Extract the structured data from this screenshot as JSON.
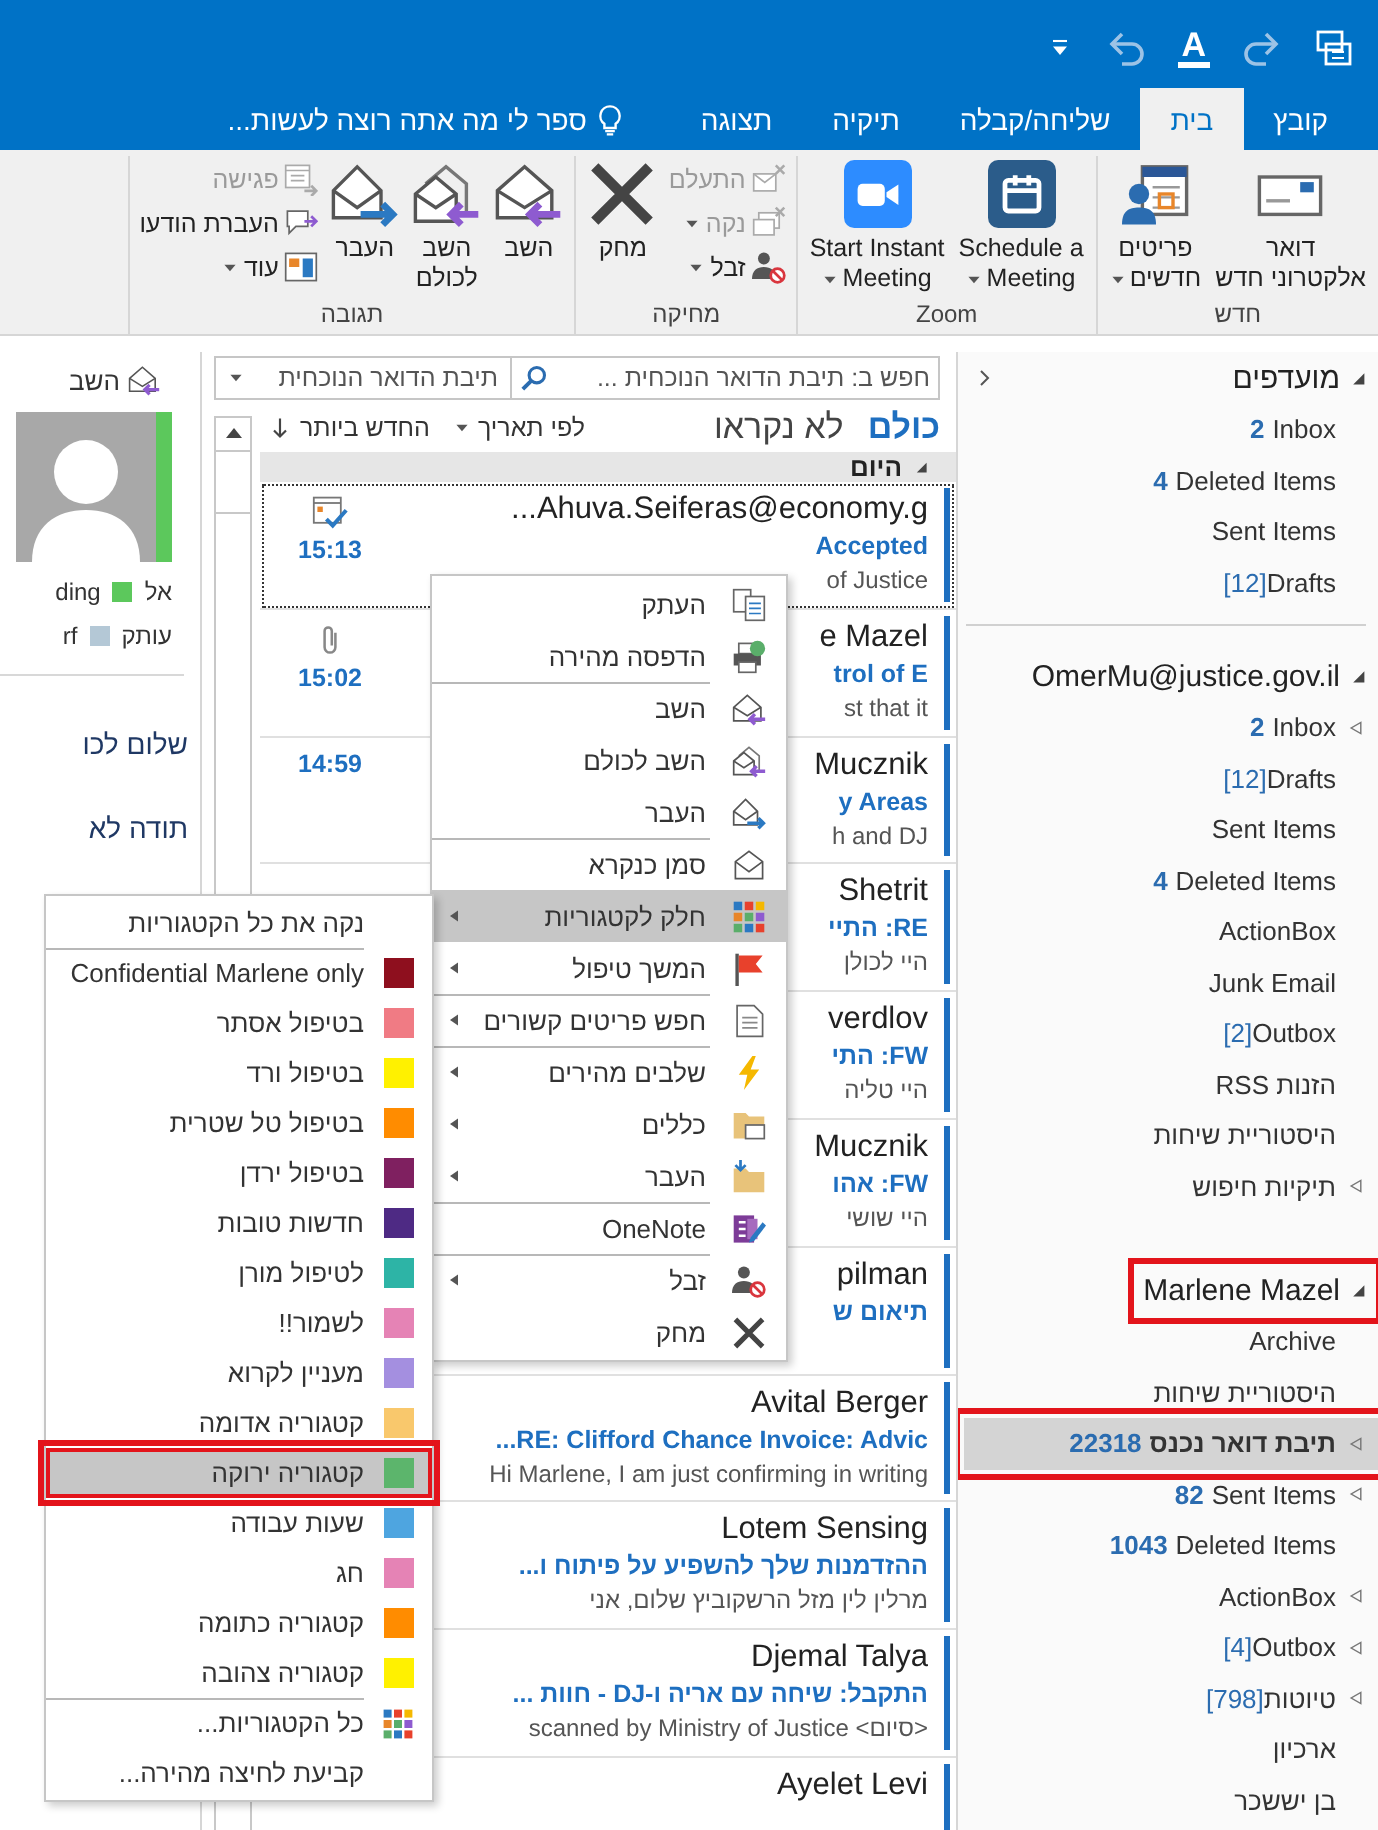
{
  "quick_access": [
    {
      "kind": "send-receive"
    },
    {
      "kind": "redo"
    },
    {
      "kind": "font",
      "label": "A"
    },
    {
      "kind": "undo"
    },
    {
      "kind": "customize"
    }
  ],
  "tabs": [
    {
      "label": "קובץ",
      "selected": false
    },
    {
      "label": "בית",
      "selected": true
    },
    {
      "label": "שליחה/קבלה",
      "selected": false
    },
    {
      "label": "תיקיה",
      "selected": false
    },
    {
      "label": "תצוגה",
      "selected": false
    }
  ],
  "tell_me": "ספר לי מה אתה רוצה לעשות...",
  "ribbon": [
    {
      "label": "חדש",
      "items": [
        {
          "kind": "new-mail",
          "label": "דואר\nאלקטרוני חדש",
          "dropdown": false,
          "disabled": false
        },
        {
          "kind": "new-items",
          "label": "פריטים\nחדשים",
          "dropdown": true,
          "disabled": false
        }
      ]
    },
    {
      "label": "Zoom",
      "items": [
        {
          "kind": "zoom-schedule",
          "label": "Schedule a\nMeeting",
          "dropdown": true,
          "disabled": false
        },
        {
          "kind": "zoom-video",
          "label": "Start Instant\nMeeting",
          "dropdown": true,
          "disabled": false
        }
      ]
    },
    {
      "label": "מחיקה",
      "items": [
        {
          "kind": "stack",
          "items": [
            {
              "kind": "ignore",
              "label": "התעלם",
              "dropdown": false,
              "disabled": true
            },
            {
              "kind": "cleanup",
              "label": "נקה",
              "dropdown": true,
              "disabled": true
            },
            {
              "kind": "junk",
              "label": "זבל",
              "dropdown": true,
              "disabled": false
            }
          ]
        },
        {
          "kind": "delete",
          "label": "מחק",
          "dropdown": false,
          "disabled": false
        }
      ]
    },
    {
      "label": "תגובה",
      "items": [
        {
          "kind": "reply",
          "label": "השב",
          "dropdown": false,
          "disabled": false
        },
        {
          "kind": "reply-all",
          "label": "השב\nלכולם",
          "dropdown": false,
          "disabled": false
        },
        {
          "kind": "forward",
          "label": "העבר",
          "dropdown": false,
          "disabled": false
        },
        {
          "kind": "stack",
          "items": [
            {
              "kind": "meeting",
              "label": "פגישה",
              "dropdown": false,
              "disabled": true
            },
            {
              "kind": "im",
              "label": "העברת הודעו",
              "dropdown": false,
              "disabled": false
            },
            {
              "kind": "more",
              "label": "עוד",
              "dropdown": true,
              "disabled": false
            }
          ]
        }
      ]
    }
  ],
  "folders": [
    {
      "title": "מועדפים",
      "expanded": true,
      "highlighted": false,
      "items": [
        {
          "name": "Inbox",
          "unread": "2",
          "collapsed": false,
          "selected": false,
          "highlighted": false
        },
        {
          "name": "Deleted Items",
          "unread": "4",
          "collapsed": false,
          "selected": false,
          "highlighted": false
        },
        {
          "name": "Sent Items",
          "collapsed": false,
          "selected": false,
          "highlighted": false
        },
        {
          "name": "Drafts",
          "total": "[12]",
          "collapsed": false,
          "selected": false,
          "highlighted": false
        }
      ]
    },
    {
      "title": "OmerMu@justice.gov.il",
      "expanded": true,
      "highlighted": false,
      "items": [
        {
          "name": "Inbox",
          "unread": "2",
          "collapsed": true,
          "selected": false,
          "highlighted": false
        },
        {
          "name": "Drafts",
          "total": "[12]",
          "collapsed": false,
          "selected": false,
          "highlighted": false
        },
        {
          "name": "Sent Items",
          "collapsed": false,
          "selected": false,
          "highlighted": false
        },
        {
          "name": "Deleted Items",
          "unread": "4",
          "collapsed": false,
          "selected": false,
          "highlighted": false
        },
        {
          "name": "ActionBox",
          "collapsed": false,
          "selected": false,
          "highlighted": false
        },
        {
          "name": "Junk Email",
          "collapsed": false,
          "selected": false,
          "highlighted": false
        },
        {
          "name": "Outbox",
          "total": "[2]",
          "collapsed": false,
          "selected": false,
          "highlighted": false
        },
        {
          "name": "הזנות RSS",
          "collapsed": false,
          "selected": false,
          "highlighted": false
        },
        {
          "name": "היסטוריית שיחות",
          "collapsed": false,
          "selected": false,
          "highlighted": false
        },
        {
          "name": "תיקיות חיפוש",
          "collapsed": true,
          "selected": false,
          "highlighted": false
        }
      ]
    },
    {
      "title": "Marlene Mazel",
      "expanded": true,
      "highlighted": true,
      "items": [
        {
          "name": "Archive",
          "collapsed": false,
          "selected": false,
          "highlighted": false
        },
        {
          "name": "היסטוריית שיחות",
          "collapsed": false,
          "selected": false,
          "highlighted": false
        },
        {
          "name": "תיבת דואר נכנס",
          "unread": "22318",
          "collapsed": true,
          "selected": true,
          "highlighted": true
        },
        {
          "name": "Sent Items",
          "unread": "82",
          "collapsed": true,
          "selected": false,
          "highlighted": false
        },
        {
          "name": "Deleted Items",
          "unread": "1043",
          "collapsed": false,
          "selected": false,
          "highlighted": false
        },
        {
          "name": "ActionBox",
          "collapsed": true,
          "selected": false,
          "highlighted": false
        },
        {
          "name": "Outbox",
          "total": "[4]",
          "collapsed": true,
          "selected": false,
          "highlighted": false
        },
        {
          "name": "טיוטות",
          "total": "[798]",
          "collapsed": true,
          "selected": false,
          "highlighted": false
        },
        {
          "name": "ארכיון",
          "collapsed": false,
          "selected": false,
          "highlighted": false
        },
        {
          "name": "בן יששכר",
          "collapsed": false,
          "selected": false,
          "highlighted": false
        }
      ]
    }
  ],
  "search": {
    "placeholder": "חפש ב: תיבת הדואר הנוכחית ...",
    "scope": "תיבת הדואר הנוכחית"
  },
  "view_filters": [
    {
      "label": "כולם",
      "selected": true
    },
    {
      "label": "לא נקראו",
      "selected": false
    }
  ],
  "sort": {
    "by": "לפי תאריך",
    "order": "החדש ביותר"
  },
  "group_header": "היום",
  "messages": [
    {
      "kind": "meeting",
      "sender": "Ahuva.Seiferas@economy.g...",
      "subject": "Accepted",
      "preview": "of Justice",
      "time": "15:13",
      "selected": true,
      "unread": true
    },
    {
      "kind": "attachment",
      "sender": "e Mazel",
      "subject": "trol of E",
      "preview": "st that it",
      "time": "15:02",
      "selected": false,
      "unread": true
    },
    {
      "kind": "mail",
      "sender": "Mucznik",
      "subject": "y Areas",
      "preview": "h and DJ",
      "time": "14:59",
      "selected": false,
      "unread": true
    },
    {
      "kind": "mail",
      "sender": "Shetrit",
      "subject": "RE: התיי",
      "preview": "היי לכולן",
      "selected": false,
      "unread": true
    },
    {
      "kind": "mail",
      "sender": "verdlov",
      "subject": "FW: התי",
      "preview": "היי טליה",
      "selected": false,
      "unread": true
    },
    {
      "kind": "mail",
      "sender": "Mucznik",
      "subject": "FW: אהו",
      "preview": "היי שושי",
      "selected": false,
      "unread": true
    },
    {
      "kind": "mail",
      "sender": "pilman",
      "subject": "תיאום ש",
      "selected": false,
      "unread": true
    },
    {
      "kind": "mail",
      "sender": "Avital Berger",
      "subject": "RE: Clifford Chance Invoice: Advic...",
      "preview": "Hi Marlene,  I am just confirming in writing",
      "selected": false,
      "unread": true
    },
    {
      "kind": "mail",
      "sender": "Lotem Sensing",
      "subject": "ההזדמנות שלך להשפיע על פיתוח ו...",
      "preview": "מרלין לין מזל הרשקוביץ שלום, אני",
      "selected": false,
      "unread": true
    },
    {
      "kind": "mail",
      "sender": "Djemal Talya",
      "subject": "התקבל: שיחה עם אריה ו-DJ - חוות ...",
      "preview": "<סיום> scanned by Ministry of Justice",
      "selected": false,
      "unread": true
    },
    {
      "kind": "mail",
      "sender": "Ayelet Levi",
      "selected": false,
      "unread": true
    }
  ],
  "reading_pane": {
    "reply": "השב",
    "recipients": [
      {
        "label": "אל",
        "name": "ding",
        "color": "#5cc85c"
      },
      {
        "label": "עותק",
        "name": "rf",
        "color": "#b4c8d6"
      }
    ],
    "body_lines": [
      "שלום לכו",
      "תודה לא"
    ]
  },
  "context_menu": [
    {
      "kind": "copy",
      "label": "העתק",
      "submenu": false,
      "separator": false,
      "selected": false
    },
    {
      "kind": "print",
      "label": "הדפסה מהירה",
      "submenu": false,
      "separator": false,
      "selected": false
    },
    {
      "kind": "reply",
      "label": "השב",
      "submenu": false,
      "separator": true,
      "selected": false
    },
    {
      "kind": "reply-all",
      "label": "השב לכולם",
      "submenu": false,
      "separator": false,
      "selected": false
    },
    {
      "kind": "forward",
      "label": "העבר",
      "submenu": false,
      "separator": false,
      "selected": false
    },
    {
      "kind": "envelope",
      "label": "סמן כנקרא",
      "submenu": false,
      "separator": true,
      "selected": false
    },
    {
      "kind": "categories",
      "label": "חלק לקטגוריות",
      "submenu": true,
      "separator": false,
      "selected": true
    },
    {
      "kind": "flag",
      "label": "המשך טיפול",
      "submenu": true,
      "separator": false,
      "selected": false
    },
    {
      "kind": "document",
      "label": "חפש פריטים קשורים",
      "submenu": true,
      "separator": true,
      "selected": false
    },
    {
      "kind": "lightning",
      "label": "שלבים מהירים",
      "submenu": true,
      "separator": true,
      "selected": false
    },
    {
      "kind": "rules",
      "label": "כללים",
      "submenu": true,
      "separator": false,
      "selected": false
    },
    {
      "kind": "move",
      "label": "העבר",
      "submenu": true,
      "separator": false,
      "selected": false
    },
    {
      "kind": "onenote",
      "label": "OneNote",
      "submenu": false,
      "separator": true,
      "selected": false
    },
    {
      "kind": "junk",
      "label": "זבל",
      "submenu": true,
      "separator": true,
      "selected": false
    },
    {
      "kind": "delete",
      "label": "מחק",
      "submenu": false,
      "separator": false,
      "selected": false
    }
  ],
  "categories": [
    {
      "label": "נקה את כל הקטגוריות",
      "kind": "clear",
      "selected": false,
      "highlighted": false,
      "separator": false
    },
    {
      "label": "Confidential Marlene only",
      "kind": "category",
      "color": "#8e0f1e",
      "selected": false,
      "highlighted": false,
      "separator": true
    },
    {
      "label": "בטיפול אסתר",
      "kind": "category",
      "color": "#f07b84",
      "selected": false,
      "highlighted": false,
      "separator": false
    },
    {
      "label": "בטיפול ורד",
      "kind": "category",
      "color": "#fff100",
      "selected": false,
      "highlighted": false,
      "separator": false
    },
    {
      "label": "בטיפול טל שטרית",
      "kind": "category",
      "color": "#ff8c00",
      "selected": false,
      "highlighted": false,
      "separator": false
    },
    {
      "label": "בטיפול ירדן",
      "kind": "category",
      "color": "#7f2060",
      "selected": false,
      "highlighted": false,
      "separator": false
    },
    {
      "label": "חדשות טובות",
      "kind": "category",
      "color": "#4e2a84",
      "selected": false,
      "highlighted": false,
      "separator": false
    },
    {
      "label": "לטיפול מורן",
      "kind": "category",
      "color": "#2db4a6",
      "selected": false,
      "highlighted": false,
      "separator": false
    },
    {
      "label": "לשמור!!",
      "kind": "category",
      "color": "#e583b5",
      "selected": false,
      "highlighted": false,
      "separator": false
    },
    {
      "label": "מעניין לקרוא",
      "kind": "category",
      "color": "#a48fe0",
      "selected": false,
      "highlighted": false,
      "separator": false
    },
    {
      "label": "קטגוריה אדומה",
      "kind": "category",
      "color": "#f9c86c",
      "selected": false,
      "highlighted": false,
      "separator": false
    },
    {
      "label": "קטגוריה ירוקה",
      "kind": "category",
      "color": "#5cb56c",
      "selected": true,
      "highlighted": true,
      "separator": false
    },
    {
      "label": "שעות עבודה",
      "kind": "category",
      "color": "#4ea5e0",
      "selected": false,
      "highlighted": false,
      "separator": false
    },
    {
      "label": "חג",
      "kind": "category",
      "color": "#e583b5",
      "selected": false,
      "highlighted": false,
      "separator": false
    },
    {
      "label": "קטגוריה כתומה",
      "kind": "category",
      "color": "#ff8c00",
      "selected": false,
      "highlighted": false,
      "separator": false
    },
    {
      "label": "קטגוריה צהובה",
      "kind": "category",
      "color": "#fff100",
      "selected": false,
      "highlighted": false,
      "separator": false
    },
    {
      "label": "כל הקטגוריות...",
      "kind": "all",
      "selected": false,
      "highlighted": false,
      "separator": true
    },
    {
      "label": "קביעת לחיצה מהירה...",
      "kind": "quick",
      "selected": false,
      "highlighted": false,
      "separator": false
    }
  ]
}
